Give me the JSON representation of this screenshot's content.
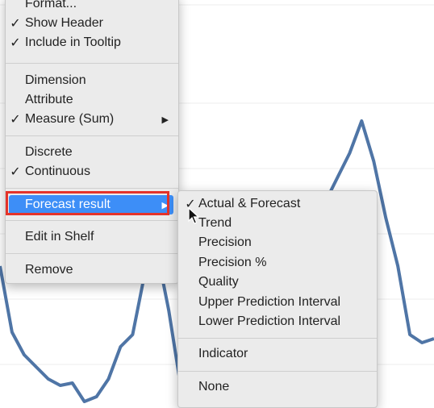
{
  "chart_data": {
    "type": "line",
    "line_color": "#4f75a6",
    "series": [
      {
        "values": [
          330,
          412,
          440,
          455,
          470,
          478,
          475,
          498,
          492,
          470,
          430,
          415,
          340,
          310,
          385,
          480,
          455,
          430,
          320,
          305,
          400,
          480,
          470,
          465,
          410,
          360,
          300,
          250,
          220,
          190,
          150,
          200,
          270,
          330,
          415,
          425,
          420
        ]
      }
    ]
  },
  "context_menu": {
    "items": [
      {
        "label": "Format...",
        "checked": false
      },
      {
        "label": "Show Header",
        "checked": true
      },
      {
        "label": "Include in Tooltip",
        "checked": true
      },
      {
        "label": "Dimension",
        "checked": false
      },
      {
        "label": "Attribute",
        "checked": false
      },
      {
        "label": "Measure (Sum)",
        "checked": true,
        "submenu_arrow": "▶"
      },
      {
        "label": "Discrete",
        "checked": false
      },
      {
        "label": "Continuous",
        "checked": true
      },
      {
        "label": "Forecast result",
        "checked": false,
        "submenu_arrow": "▶"
      },
      {
        "label": "Edit in Shelf",
        "checked": false
      },
      {
        "label": "Remove",
        "checked": false
      }
    ],
    "check_glyph": "✓",
    "highlight_color": "#3d8ef7",
    "annotation_color": "#e4332a"
  },
  "forecast_submenu": {
    "items": [
      {
        "label": "Actual & Forecast",
        "checked": true
      },
      {
        "label": "Trend",
        "checked": false
      },
      {
        "label": "Precision",
        "checked": false
      },
      {
        "label": "Precision %",
        "checked": false
      },
      {
        "label": "Quality",
        "checked": false
      },
      {
        "label": "Upper Prediction Interval",
        "checked": false
      },
      {
        "label": "Lower Prediction Interval",
        "checked": false
      },
      {
        "label": "Indicator",
        "checked": false
      },
      {
        "label": "None",
        "checked": false
      }
    ]
  }
}
